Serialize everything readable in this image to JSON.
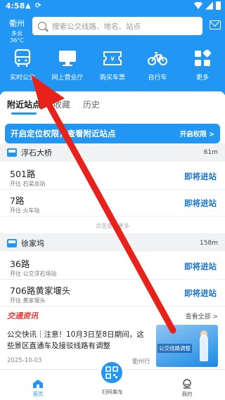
{
  "status_bar": {
    "time": "4:58"
  },
  "header": {
    "city": "衢州",
    "weather": "多云 36°C",
    "search_placeholder": "搜索公交线路、地名、站点"
  },
  "menu": [
    {
      "label": "实时公交",
      "icon": "bus-icon"
    },
    {
      "label": "网上营业厅",
      "icon": "monitor-icon"
    },
    {
      "label": "购买车票",
      "icon": "ticket-icon"
    },
    {
      "label": "自行车",
      "icon": "bicycle-icon"
    },
    {
      "label": "更多",
      "icon": "more-icon"
    }
  ],
  "tabs": [
    "附近站点",
    "收藏",
    "历史"
  ],
  "permission_banner": {
    "text": "开启定位权限，查看附近站点",
    "button": "开启权限 >"
  },
  "stops": [
    {
      "name": "浮石大桥",
      "distance": "61m",
      "routes": [
        {
          "name": "501路",
          "direction": "开往 石梁总站",
          "status": "即将进站"
        },
        {
          "name": "7路",
          "direction": "开往 火车站",
          "status": "即将进站"
        }
      ],
      "more": "点击查看更多"
    },
    {
      "name": "徐家坞",
      "distance": "158m",
      "routes": [
        {
          "name": "36路",
          "direction": "开往 公交浮石场站",
          "status": "即将进站"
        },
        {
          "name": "706路黄家堰头",
          "direction": "开往 黄家堰头",
          "status": "即将进站"
        }
      ]
    }
  ],
  "news": {
    "section_title": "交通资讯",
    "view_all": "查看全部 >",
    "headline": "公交快讯｜注意！10月3日至8日期间，这些景区直通车及接驳线路有调整",
    "date": "2025-10-03",
    "source": "衢州行",
    "image_caption": "公交线路调整"
  },
  "bottom_nav": {
    "home": "首页",
    "scan": "扫码乘车",
    "mine": "我的"
  },
  "colors": {
    "primary": "#2196f3",
    "arrow": "#e8221b",
    "news_title": "#e53935"
  }
}
